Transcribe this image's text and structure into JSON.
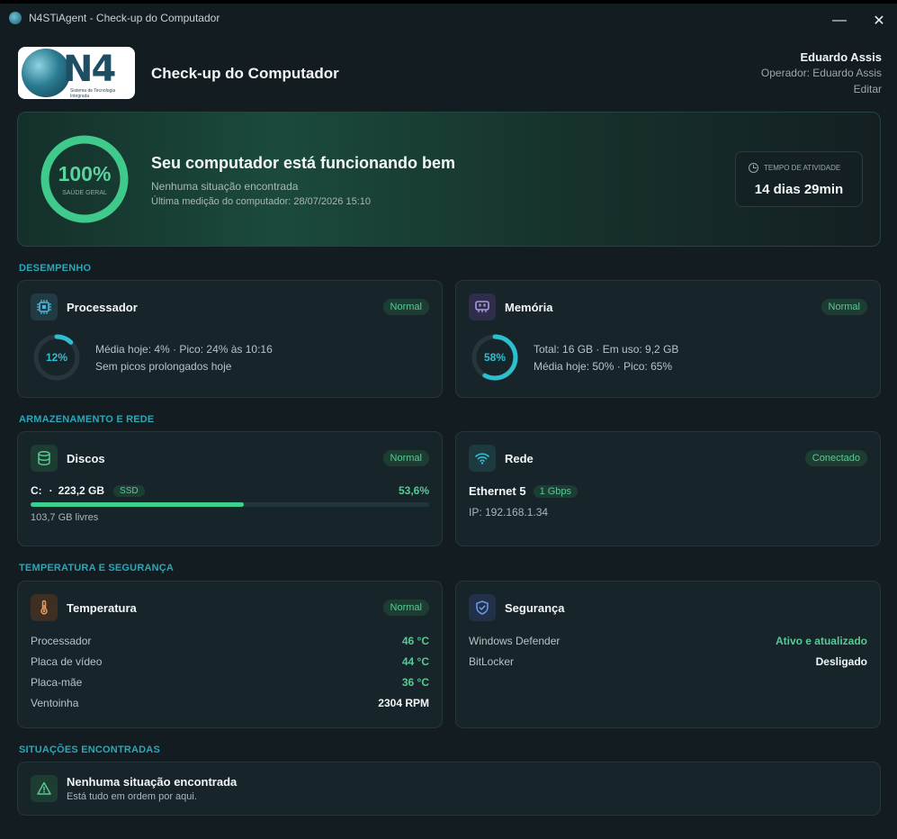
{
  "window": {
    "title": "N4STiAgent - Check-up do Computador",
    "minimize": "—",
    "close": "✕"
  },
  "header": {
    "logo_text": "N4",
    "logo_subtitle": "Sistema de Tecnologia Integrada",
    "page_title": "Check-up do Computador",
    "user_name": "Eduardo Assis",
    "operator": "Operador: Eduardo Assis",
    "edit_label": "Editar"
  },
  "hero": {
    "health_percent": "100%",
    "health_value": 100,
    "health_label": "SAÚDE GERAL",
    "title": "Seu computador está funcionando bem",
    "subtitle": "Nenhuma situação encontrada",
    "last_measurement": "Última medição do computador: 28/07/2026 15:10",
    "uptime_label": "TEMPO DE ATIVIDADE",
    "uptime_value": "14 dias 29min"
  },
  "sections": {
    "performance": "DESEMPENHO",
    "storage_network": "ARMAZENAMENTO E REDE",
    "temperature_security": "TEMPERATURA E SEGURANÇA",
    "issues": "SITUAÇÕES ENCONTRADAS"
  },
  "cpu": {
    "title": "Processador",
    "status": "Normal",
    "usage_label": "12%",
    "usage_value": 12,
    "line1": "Média hoje: 4% · Pico: 24% às 10:16",
    "line2": "Sem picos prolongados hoje"
  },
  "memory": {
    "title": "Memória",
    "status": "Normal",
    "usage_label": "58%",
    "usage_value": 58,
    "line1": "Total: 16 GB · Em uso: 9,2 GB",
    "line2": "Média hoje: 50% · Pico: 65%"
  },
  "disks": {
    "title": "Discos",
    "status": "Normal",
    "drive": "C:",
    "separator": "·",
    "size": "223,2 GB",
    "type": "SSD",
    "used_label": "53,6%",
    "used_value": 53.6,
    "free": "103,7 GB livres"
  },
  "network": {
    "title": "Rede",
    "status": "Conectado",
    "adapter": "Ethernet 5",
    "speed": "1 Gbps",
    "ip": "IP: 192.168.1.34"
  },
  "temperature": {
    "title": "Temperatura",
    "status": "Normal",
    "rows": [
      {
        "label": "Processador",
        "value": "46 °C"
      },
      {
        "label": "Placa de vídeo",
        "value": "44 °C"
      },
      {
        "label": "Placa-mãe",
        "value": "36 °C"
      },
      {
        "label": "Ventoinha",
        "value": "2304 RPM"
      }
    ]
  },
  "security": {
    "title": "Segurança",
    "rows": [
      {
        "label": "Windows Defender",
        "value": "Ativo e atualizado"
      },
      {
        "label": "BitLocker",
        "value": "Desligado"
      }
    ]
  },
  "issues": {
    "title": "Nenhuma situação encontrada",
    "subtitle": "Está tudo em ordem por aqui."
  },
  "colors": {
    "accent_green": "#58c994",
    "accent_teal": "#2ebfcf",
    "background": "#121c21",
    "card": "#17252b"
  }
}
